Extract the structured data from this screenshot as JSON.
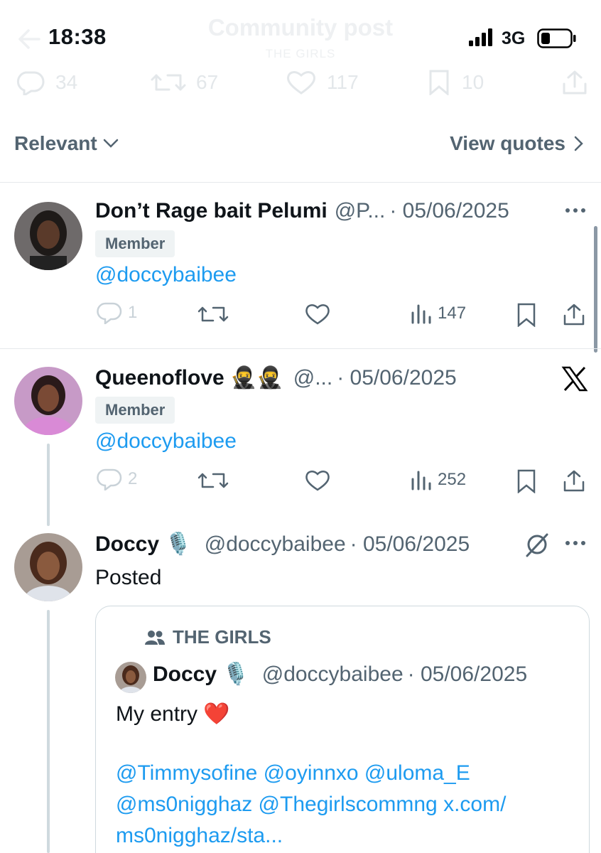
{
  "status_bar": {
    "time": "18:38",
    "network": "3G"
  },
  "header": {
    "title": "Community post",
    "subtitle": "THE GIRLS"
  },
  "top_actions": {
    "replies": "34",
    "reposts": "67",
    "likes": "117",
    "bookmarks": "10"
  },
  "sort": {
    "label": "Relevant",
    "view_quotes": "View quotes"
  },
  "posts": [
    {
      "name": "Don’t Rage bait Pelumi",
      "handle": "@P...",
      "date": "· 05/06/2025",
      "badge": "Member",
      "text": "@doccybaibee",
      "replies": "1",
      "views": "147"
    },
    {
      "name": "Queenoflove 🥷🥷",
      "handle": "@...",
      "date": "· 05/06/2025",
      "badge": "Member",
      "text": "@doccybaibee",
      "replies": "2",
      "views": "252"
    },
    {
      "name": "Doccy 🎙️",
      "handle": "@doccybaibee",
      "date": "· 05/06/2025",
      "text": "Posted"
    }
  ],
  "quote": {
    "community": "THE GIRLS",
    "name": "Doccy 🎙️",
    "handle": "@doccybaibee",
    "date": "· 05/06/2025",
    "text": "My entry ❤️",
    "mentions_line1": "@Timmysofine @oyinnxo @uloma_E",
    "mentions_line2": "@ms0nigghaz @Thegirlscommng x.com/",
    "mentions_line3": "ms0nigghaz/sta..."
  },
  "colors": {
    "link": "#1d9bf0",
    "secondary": "#536471",
    "divider": "#e6e9ec"
  }
}
